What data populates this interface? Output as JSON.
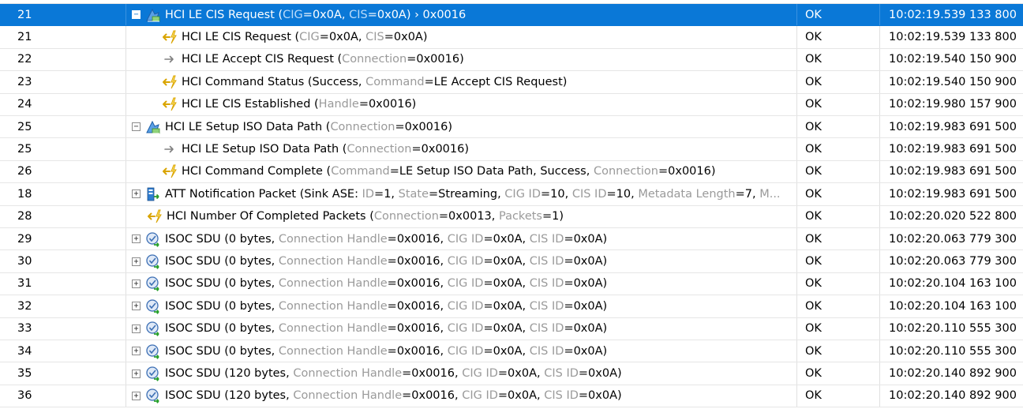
{
  "colors": {
    "selection": "#0a78d7",
    "field_key": "#9a9a9a",
    "event_icon": "#d9a400",
    "command_arrow": "#808080"
  },
  "rows": [
    {
      "num": "21",
      "status": "OK",
      "time": "10:02:19.539 133 800",
      "indent": 0,
      "expander": "−",
      "icon": "le-transaction-icon",
      "selected": true,
      "segs": [
        {
          "t": "HCI LE CIS Request ("
        },
        {
          "k": "CIG"
        },
        {
          "t": "=0x0A, "
        },
        {
          "k": "CIS"
        },
        {
          "t": "=0x0A) › 0x0016"
        }
      ]
    },
    {
      "num": "21",
      "status": "OK",
      "time": "10:02:19.539 133 800",
      "indent": 1,
      "expander": "",
      "icon": "event-icon",
      "segs": [
        {
          "t": "HCI LE CIS Request ("
        },
        {
          "k": "CIG"
        },
        {
          "t": "=0x0A, "
        },
        {
          "k": "CIS"
        },
        {
          "t": "=0x0A)"
        }
      ]
    },
    {
      "num": "22",
      "status": "OK",
      "time": "10:02:19.540 150 900",
      "indent": 1,
      "expander": "",
      "icon": "command-arrow-icon",
      "segs": [
        {
          "t": "HCI LE Accept CIS Request ("
        },
        {
          "k": "Connection"
        },
        {
          "t": "=0x0016)"
        }
      ]
    },
    {
      "num": "23",
      "status": "OK",
      "time": "10:02:19.540 150 900",
      "indent": 1,
      "expander": "",
      "icon": "event-icon",
      "segs": [
        {
          "t": "HCI Command Status (Success, "
        },
        {
          "k": "Command"
        },
        {
          "t": "=LE Accept CIS Request)"
        }
      ]
    },
    {
      "num": "24",
      "status": "OK",
      "time": "10:02:19.980 157 900",
      "indent": 1,
      "expander": "",
      "icon": "event-icon",
      "segs": [
        {
          "t": "HCI LE CIS Established ("
        },
        {
          "k": "Handle"
        },
        {
          "t": "=0x0016)"
        }
      ]
    },
    {
      "num": "25",
      "status": "OK",
      "time": "10:02:19.983 691 500",
      "indent": 0,
      "expander": "−",
      "icon": "le-transaction-icon",
      "segs": [
        {
          "t": "HCI LE Setup ISO Data Path ("
        },
        {
          "k": "Connection"
        },
        {
          "t": "=0x0016)"
        }
      ]
    },
    {
      "num": "25",
      "status": "OK",
      "time": "10:02:19.983 691 500",
      "indent": 1,
      "expander": "",
      "icon": "command-arrow-icon",
      "segs": [
        {
          "t": "HCI LE Setup ISO Data Path ("
        },
        {
          "k": "Connection"
        },
        {
          "t": "=0x0016)"
        }
      ]
    },
    {
      "num": "26",
      "status": "OK",
      "time": "10:02:19.983 691 500",
      "indent": 1,
      "expander": "",
      "icon": "event-icon",
      "segs": [
        {
          "t": "HCI Command Complete ("
        },
        {
          "k": "Command"
        },
        {
          "t": "=LE Setup ISO Data Path, Success, "
        },
        {
          "k": "Connection"
        },
        {
          "t": "=0x0016)"
        }
      ]
    },
    {
      "num": "18",
      "status": "OK",
      "time": "10:02:19.983 691 500",
      "indent": 0,
      "expander": "+",
      "icon": "att-packet-icon",
      "segs": [
        {
          "t": "ATT Notification Packet (Sink ASE: "
        },
        {
          "k": "ID"
        },
        {
          "t": "=1, "
        },
        {
          "k": "State"
        },
        {
          "t": "=Streaming, "
        },
        {
          "k": "CIG ID"
        },
        {
          "t": "=10, "
        },
        {
          "k": "CIS ID"
        },
        {
          "t": "=10, "
        },
        {
          "k": "Metadata Length"
        },
        {
          "t": "=7, "
        },
        {
          "k": "M..."
        }
      ]
    },
    {
      "num": "28",
      "status": "OK",
      "time": "10:02:20.020 522 800",
      "indent": 0.5,
      "expander": "",
      "icon": "event-icon",
      "segs": [
        {
          "t": "HCI Number Of Completed Packets ("
        },
        {
          "k": "Connection"
        },
        {
          "t": "=0x0013, "
        },
        {
          "k": "Packets"
        },
        {
          "t": "=1)"
        }
      ]
    },
    {
      "num": "29",
      "status": "OK",
      "time": "10:02:20.063 779 300",
      "indent": 0,
      "expander": "+",
      "icon": "isoc-sdu-icon",
      "segs": [
        {
          "t": "ISOC SDU (0 bytes, "
        },
        {
          "k": "Connection Handle"
        },
        {
          "t": "=0x0016, "
        },
        {
          "k": "CIG ID"
        },
        {
          "t": "=0x0A, "
        },
        {
          "k": "CIS ID"
        },
        {
          "t": "=0x0A)"
        }
      ]
    },
    {
      "num": "30",
      "status": "OK",
      "time": "10:02:20.063 779 300",
      "indent": 0,
      "expander": "+",
      "icon": "isoc-sdu-icon",
      "segs": [
        {
          "t": "ISOC SDU (0 bytes, "
        },
        {
          "k": "Connection Handle"
        },
        {
          "t": "=0x0016, "
        },
        {
          "k": "CIG ID"
        },
        {
          "t": "=0x0A, "
        },
        {
          "k": "CIS ID"
        },
        {
          "t": "=0x0A)"
        }
      ]
    },
    {
      "num": "31",
      "status": "OK",
      "time": "10:02:20.104 163 100",
      "indent": 0,
      "expander": "+",
      "icon": "isoc-sdu-icon",
      "segs": [
        {
          "t": "ISOC SDU (0 bytes, "
        },
        {
          "k": "Connection Handle"
        },
        {
          "t": "=0x0016, "
        },
        {
          "k": "CIG ID"
        },
        {
          "t": "=0x0A, "
        },
        {
          "k": "CIS ID"
        },
        {
          "t": "=0x0A)"
        }
      ]
    },
    {
      "num": "32",
      "status": "OK",
      "time": "10:02:20.104 163 100",
      "indent": 0,
      "expander": "+",
      "icon": "isoc-sdu-icon",
      "segs": [
        {
          "t": "ISOC SDU (0 bytes, "
        },
        {
          "k": "Connection Handle"
        },
        {
          "t": "=0x0016, "
        },
        {
          "k": "CIG ID"
        },
        {
          "t": "=0x0A, "
        },
        {
          "k": "CIS ID"
        },
        {
          "t": "=0x0A)"
        }
      ]
    },
    {
      "num": "33",
      "status": "OK",
      "time": "10:02:20.110 555 300",
      "indent": 0,
      "expander": "+",
      "icon": "isoc-sdu-icon",
      "segs": [
        {
          "t": "ISOC SDU (0 bytes, "
        },
        {
          "k": "Connection Handle"
        },
        {
          "t": "=0x0016, "
        },
        {
          "k": "CIG ID"
        },
        {
          "t": "=0x0A, "
        },
        {
          "k": "CIS ID"
        },
        {
          "t": "=0x0A)"
        }
      ]
    },
    {
      "num": "34",
      "status": "OK",
      "time": "10:02:20.110 555 300",
      "indent": 0,
      "expander": "+",
      "icon": "isoc-sdu-icon",
      "segs": [
        {
          "t": "ISOC SDU (0 bytes, "
        },
        {
          "k": "Connection Handle"
        },
        {
          "t": "=0x0016, "
        },
        {
          "k": "CIG ID"
        },
        {
          "t": "=0x0A, "
        },
        {
          "k": "CIS ID"
        },
        {
          "t": "=0x0A)"
        }
      ]
    },
    {
      "num": "35",
      "status": "OK",
      "time": "10:02:20.140 892 900",
      "indent": 0,
      "expander": "+",
      "icon": "isoc-sdu-icon",
      "segs": [
        {
          "t": "ISOC SDU (120 bytes, "
        },
        {
          "k": "Connection Handle"
        },
        {
          "t": "=0x0016, "
        },
        {
          "k": "CIG ID"
        },
        {
          "t": "=0x0A, "
        },
        {
          "k": "CIS ID"
        },
        {
          "t": "=0x0A)"
        }
      ]
    },
    {
      "num": "36",
      "status": "OK",
      "time": "10:02:20.140 892 900",
      "indent": 0,
      "expander": "+",
      "icon": "isoc-sdu-icon",
      "segs": [
        {
          "t": "ISOC SDU (120 bytes, "
        },
        {
          "k": "Connection Handle"
        },
        {
          "t": "=0x0016, "
        },
        {
          "k": "CIG ID"
        },
        {
          "t": "=0x0A, "
        },
        {
          "k": "CIS ID"
        },
        {
          "t": "=0x0A)"
        }
      ]
    }
  ]
}
